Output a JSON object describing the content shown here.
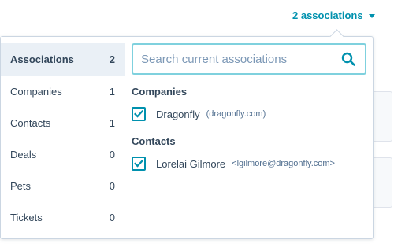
{
  "header": {
    "associations_toggle_label": "2 associations"
  },
  "sidebar": {
    "items": [
      {
        "label": "Associations",
        "count": "2"
      },
      {
        "label": "Companies",
        "count": "1"
      },
      {
        "label": "Contacts",
        "count": "1"
      },
      {
        "label": "Deals",
        "count": "0"
      },
      {
        "label": "Pets",
        "count": "0"
      },
      {
        "label": "Tickets",
        "count": "0"
      }
    ]
  },
  "search": {
    "placeholder": "Search current associations",
    "value": ""
  },
  "groups": [
    {
      "title": "Companies",
      "items": [
        {
          "name": "Dragonfly",
          "detail": "(dragonfly.com)",
          "checked": true
        }
      ]
    },
    {
      "title": "Contacts",
      "items": [
        {
          "name": "Lorelai Gilmore",
          "detail": "<lgilmore@dragonfly.com>",
          "checked": true
        }
      ]
    }
  ],
  "colors": {
    "accent": "#0091ae",
    "text": "#33475b",
    "active_bg": "#eaf0f6"
  },
  "icons": {
    "toggle": "caret-down-icon",
    "search": "search-icon",
    "checkbox": "checkmark-icon"
  }
}
